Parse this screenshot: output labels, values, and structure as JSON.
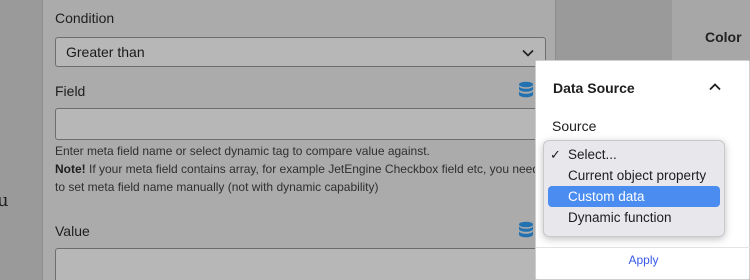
{
  "background": {
    "right_header": "Color",
    "left_letter": "u",
    "right_bits": [
      "ı",
      "ıı",
      "ıı"
    ]
  },
  "form": {
    "condition_label": "Condition",
    "condition_value": "Greater than",
    "field_label": "Field",
    "field_value": "",
    "help_line1": "Enter meta field name or select dynamic tag to compare value against.",
    "help_note_bold": "Note!",
    "help_note_rest": " If your meta field contains array, for example JetEngine Checkbox field etc, you need to set meta field name manually (not with dynamic capability)",
    "value_label": "Value",
    "value_value": ""
  },
  "popover": {
    "title": "Data Source",
    "source_label": "Source",
    "apply_label": "Apply",
    "options": [
      {
        "label": "Select...",
        "checked": true
      },
      {
        "label": "Current object property",
        "checked": false
      },
      {
        "label": "Custom data",
        "checked": false,
        "highlighted": true
      },
      {
        "label": "Dynamic function",
        "checked": false
      }
    ]
  },
  "colors": {
    "accent": "#3858e9",
    "highlight": "#4a8cf0",
    "db_icon": "#2271b1"
  }
}
